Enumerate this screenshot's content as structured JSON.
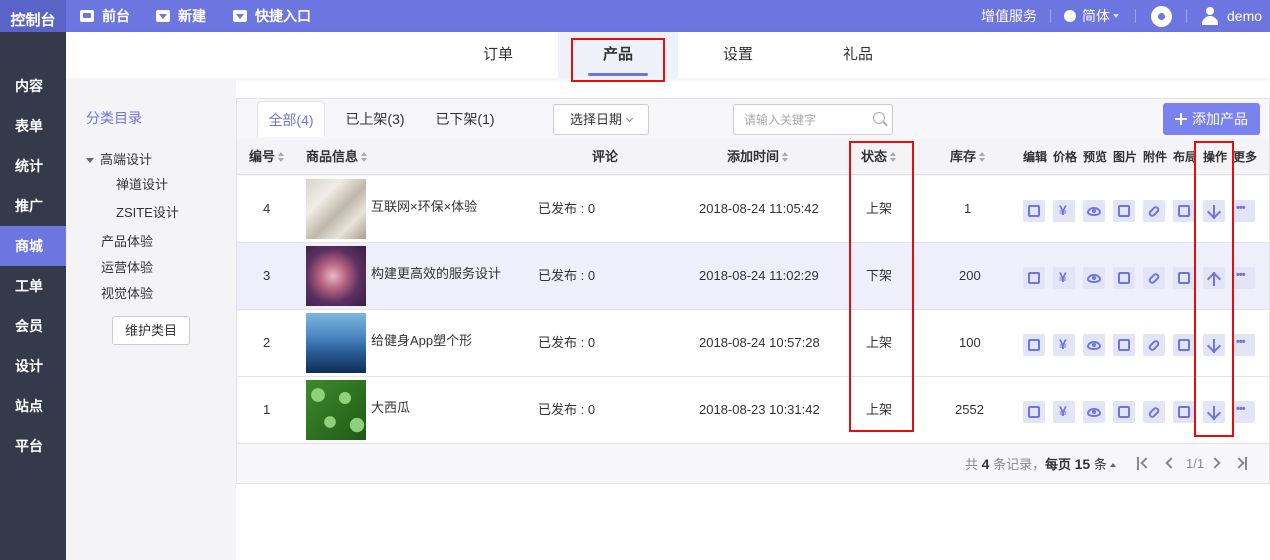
{
  "topbar": {
    "logo": "控制台",
    "nav": [
      {
        "label": "前台",
        "icon": "monitor-icon"
      },
      {
        "label": "新建",
        "icon": "download-icon"
      },
      {
        "label": "快捷入口",
        "icon": "download-icon"
      }
    ],
    "value_added": "增值服务",
    "language": "简体",
    "user": "demo"
  },
  "sidebar": {
    "items": [
      "内容",
      "表单",
      "统计",
      "推广",
      "商城",
      "工单",
      "会员",
      "设计",
      "站点",
      "平台"
    ],
    "active": "商城"
  },
  "main_tabs": {
    "items": [
      "订单",
      "产品",
      "设置",
      "礼品"
    ],
    "active": "产品"
  },
  "categories": {
    "title": "分类目录",
    "tree": [
      "高端设计",
      "禅道设计",
      "ZSITE设计",
      "产品体验",
      "运营体验",
      "视觉体验"
    ],
    "maintain_button": "维护类目"
  },
  "filters": {
    "tabs": [
      "全部(4)",
      "已上架(3)",
      "已下架(1)"
    ],
    "active": "全部(4)",
    "date_button": "选择日期",
    "search_placeholder": "请输入关键字",
    "add_button": "添加产品"
  },
  "table": {
    "headers": {
      "id": "编号",
      "info": "商品信息",
      "comment": "评论",
      "added": "添加时间",
      "status": "状态",
      "stock": "库存",
      "edit": "编辑",
      "price": "价格",
      "preview": "预览",
      "image": "图片",
      "attach": "附件",
      "layout": "布局",
      "action": "操作",
      "more": "更多"
    },
    "rows": [
      {
        "id": "4",
        "name": "互联网×环保×体验",
        "comment": "已发布 : 0",
        "added": "2018-08-24 11:05:42",
        "status": "上架",
        "stock": "1",
        "action": "arrow-down-icon"
      },
      {
        "id": "3",
        "name": "构建更高效的服务设计",
        "comment": "已发布 : 0",
        "added": "2018-08-24 11:02:29",
        "status": "下架",
        "stock": "200",
        "action": "arrow-up-icon"
      },
      {
        "id": "2",
        "name": "给健身App塑个形",
        "comment": "已发布 : 0",
        "added": "2018-08-24 10:57:28",
        "status": "上架",
        "stock": "100",
        "action": "arrow-down-icon"
      },
      {
        "id": "1",
        "name": "大西瓜",
        "comment": "已发布 : 0",
        "added": "2018-08-23 10:31:42",
        "status": "上架",
        "stock": "2552",
        "action": "arrow-down-icon"
      }
    ]
  },
  "pager": {
    "total_prefix": "共",
    "total": "4",
    "total_suffix": "条记录，",
    "per_page_prefix": "每页",
    "per_page": "15",
    "per_page_suffix": "条",
    "page": "1/1"
  },
  "colors": {
    "accent": "#6c75e0",
    "highlight": "#e01010",
    "sidebar": "#353a4a"
  }
}
